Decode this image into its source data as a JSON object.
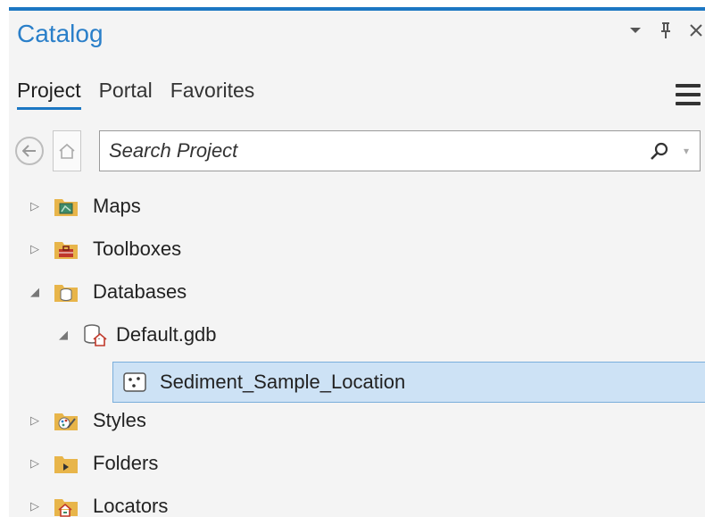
{
  "panel": {
    "title": "Catalog",
    "controls": {
      "dropdown": "▾",
      "pin": "⊥",
      "close": "×"
    }
  },
  "tabs": [
    {
      "label": "Project",
      "active": true
    },
    {
      "label": "Portal",
      "active": false
    },
    {
      "label": "Favorites",
      "active": false
    }
  ],
  "search": {
    "placeholder": "Search Project"
  },
  "tree": {
    "items": [
      {
        "label": "Maps",
        "icon": "maps-folder-icon",
        "expanded": false
      },
      {
        "label": "Toolboxes",
        "icon": "toolboxes-folder-icon",
        "expanded": false
      },
      {
        "label": "Databases",
        "icon": "databases-folder-icon",
        "expanded": true
      },
      {
        "label": "Default.gdb",
        "icon": "geodatabase-icon",
        "expanded": true
      },
      {
        "label": "Sediment_Sample_Location",
        "icon": "point-feature-class-icon",
        "selected": true
      },
      {
        "label": "Styles",
        "icon": "styles-folder-icon",
        "expanded": false
      },
      {
        "label": "Folders",
        "icon": "folders-folder-icon",
        "expanded": false
      },
      {
        "label": "Locators",
        "icon": "locators-folder-icon",
        "expanded": false
      }
    ]
  },
  "colors": {
    "accent": "#1c77c3",
    "selection": "#cde2f5",
    "folder": "#e8b54a"
  }
}
